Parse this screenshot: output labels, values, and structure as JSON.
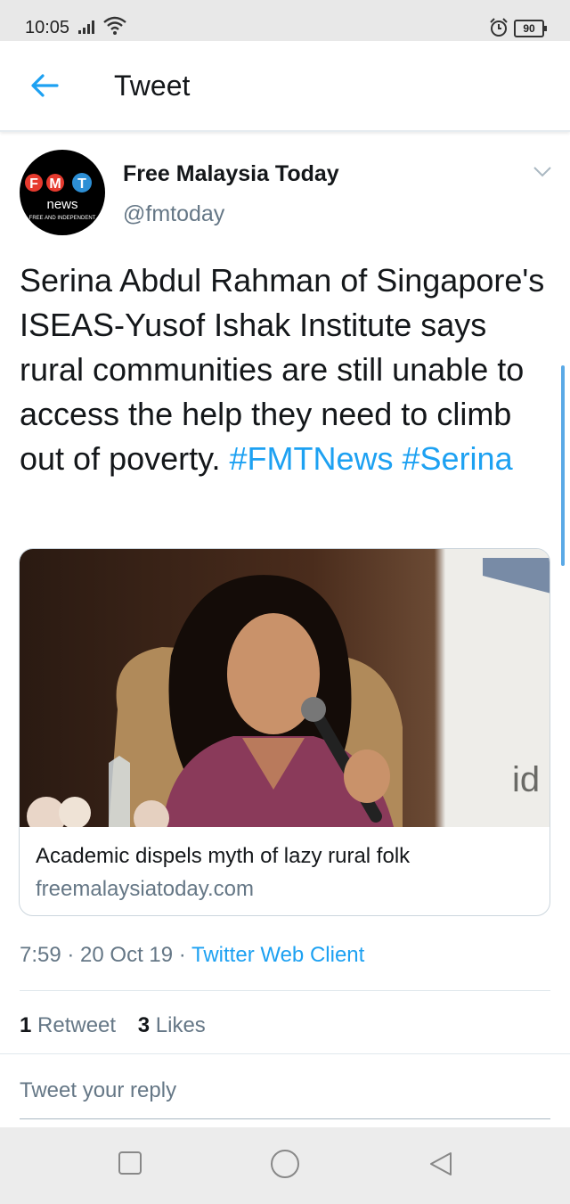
{
  "status": {
    "time": "10:05",
    "battery": "90"
  },
  "header": {
    "title": "Tweet"
  },
  "author": {
    "name": "Free Malaysia Today",
    "handle": "@fmtoday",
    "avatar": {
      "letters": [
        "F",
        "M",
        "T"
      ],
      "sub": "news",
      "tagline": "FREE AND INDEPENDENT"
    }
  },
  "tweet": {
    "text": "Serina Abdul Rahman of Singapore's ISEAS-Yusof Ishak Institute says rural communities are still unable to access the help they need to climb out of poverty.",
    "hashtags": [
      "#FMTNews",
      "#Serina"
    ]
  },
  "card": {
    "title": "Academic dispels myth of lazy rural folk",
    "domain": "freemalaysiatoday.com",
    "image_text": "id"
  },
  "meta": {
    "time": "7:59",
    "date": "20 Oct 19",
    "sep": " · ",
    "client": "Twitter Web Client"
  },
  "stats": {
    "retweets": "1",
    "retweet_label": "Retweet",
    "likes": "3",
    "likes_label": "Likes"
  },
  "reply": {
    "placeholder": "Tweet your reply"
  },
  "colors": {
    "accent": "#1da1f2",
    "secondary_text": "#657786",
    "brand_red": "#e63a2e",
    "brand_blue": "#2d8fd5"
  },
  "icons": [
    "back-arrow-icon",
    "chevron-down-icon",
    "signal-icon",
    "wifi-icon",
    "alarm-icon",
    "square-nav-icon",
    "circle-nav-icon",
    "triangle-back-icon"
  ]
}
